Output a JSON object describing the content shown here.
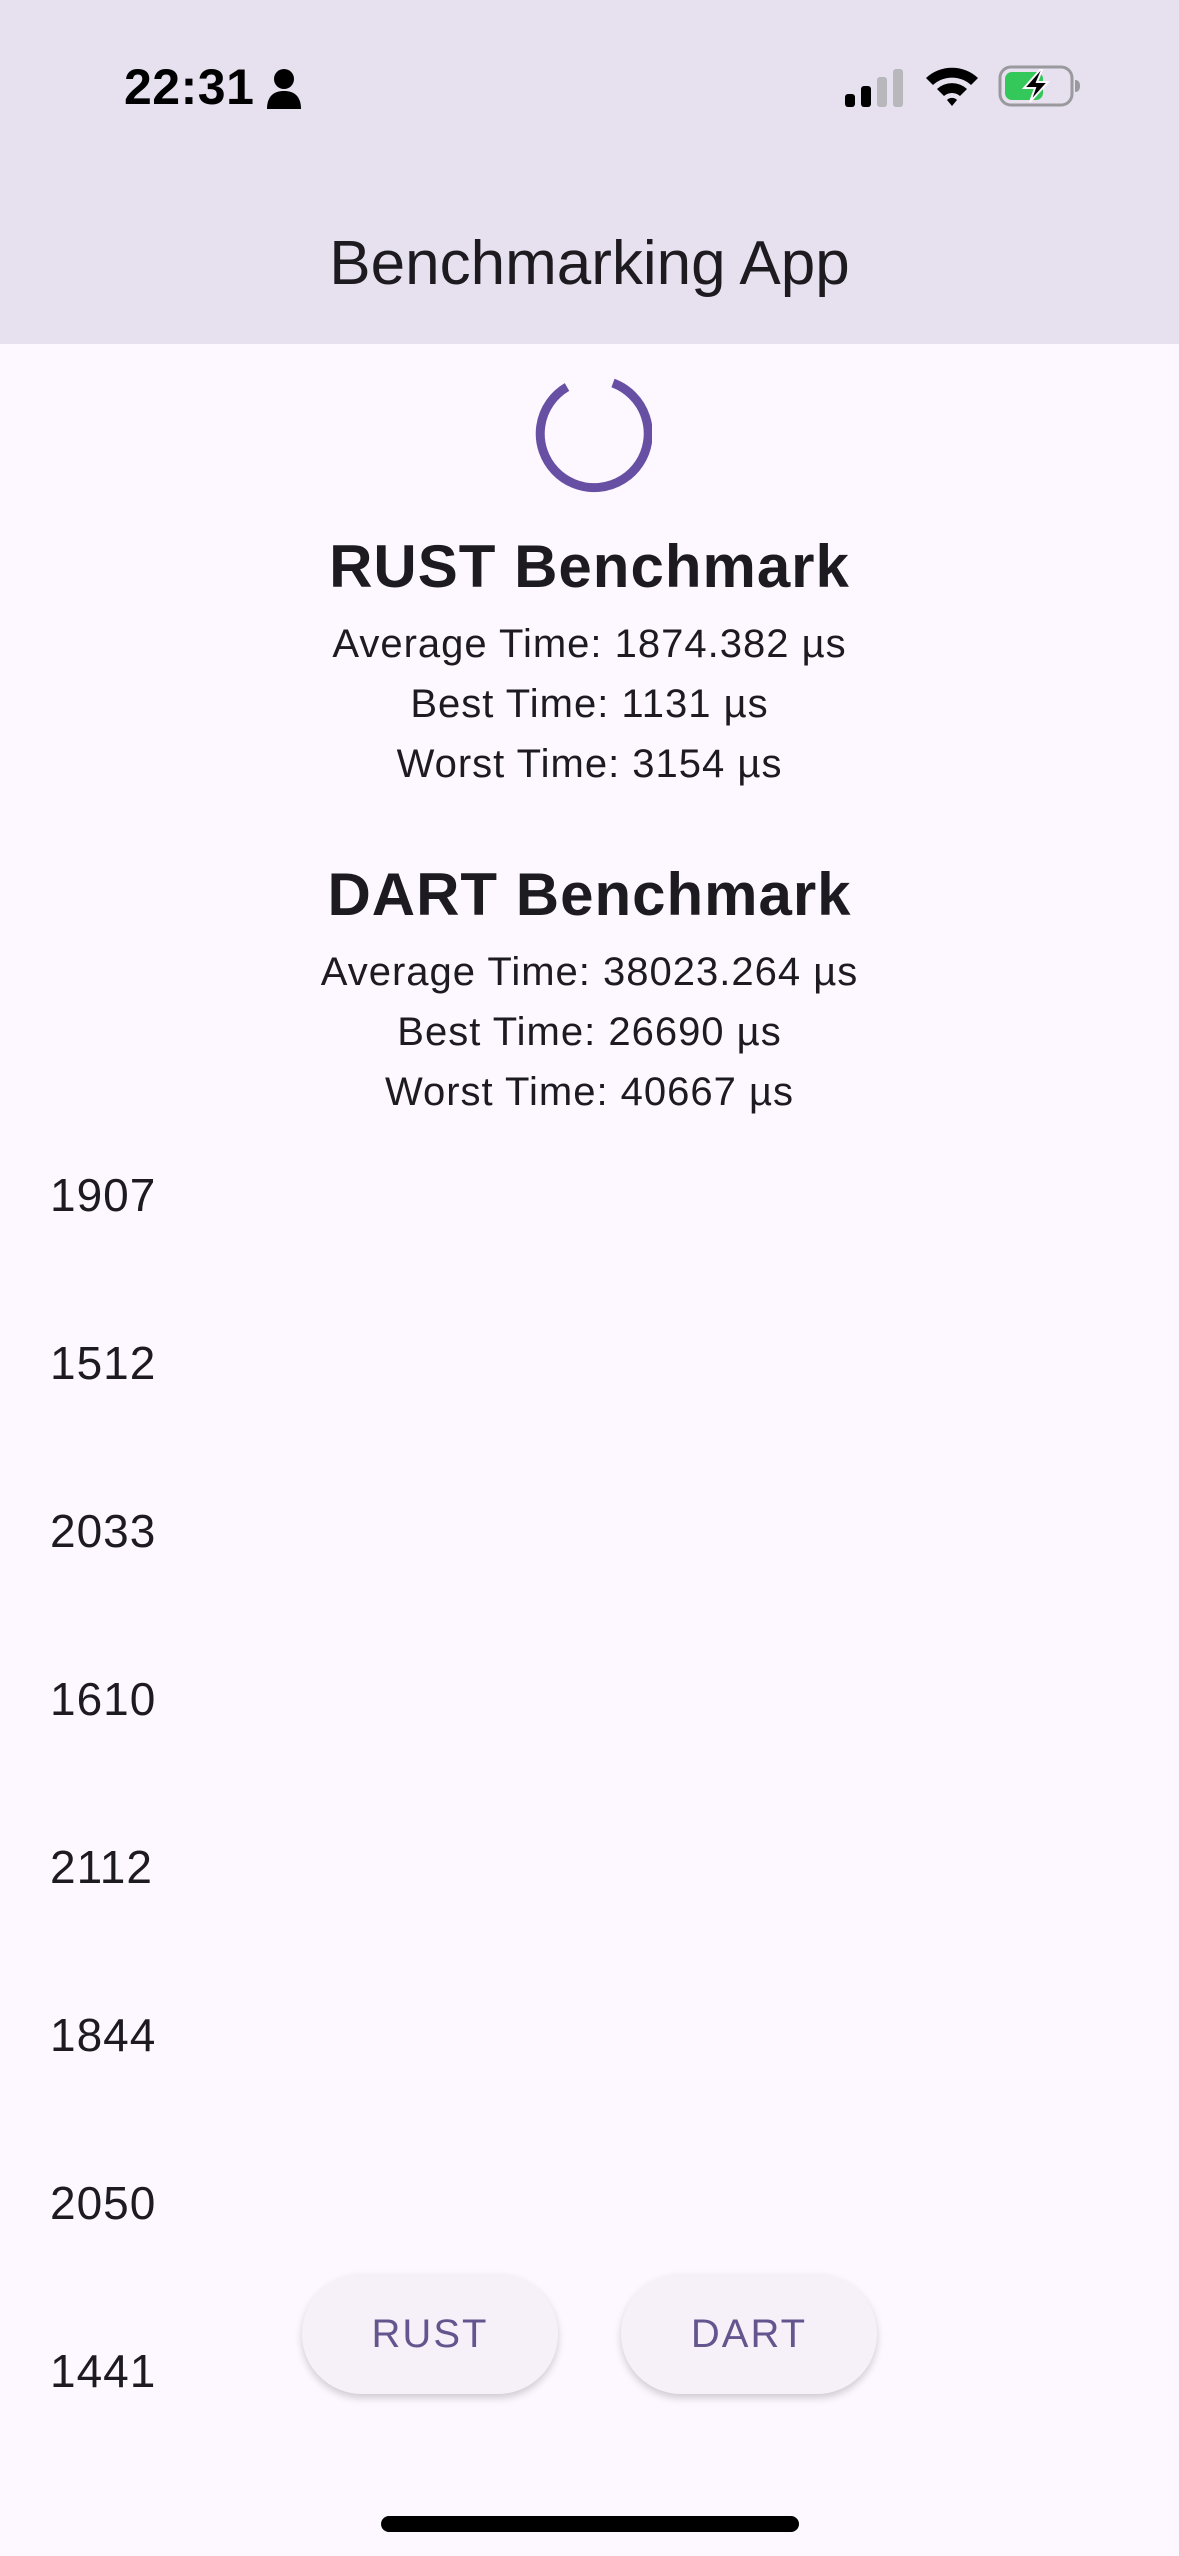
{
  "status_bar": {
    "time": "22:31",
    "icons": [
      "person-icon",
      "cellular-signal-icon",
      "wifi-icon",
      "battery-charging-icon"
    ]
  },
  "app_bar": {
    "title": "Benchmarking App"
  },
  "loading": {
    "icon": "circular-progress-icon",
    "color": "#6750a4"
  },
  "benchmarks": {
    "rust": {
      "title": "RUST Benchmark",
      "average": "Average Time: 1874.382 µs",
      "best": "Best Time: 1131 µs",
      "worst": "Worst Time: 3154 µs"
    },
    "dart": {
      "title": "DART Benchmark",
      "average": "Average Time: 38023.264 µs",
      "best": "Best Time: 26690 µs",
      "worst": "Worst Time: 40667 µs"
    }
  },
  "results": [
    "1907",
    "1512",
    "2033",
    "1610",
    "2112",
    "1844",
    "2050",
    "1441"
  ],
  "buttons": {
    "rust_label": "RUST",
    "dart_label": "DART"
  },
  "colors": {
    "app_bar_bg": "#e7e0ef",
    "background": "#fdf7ff",
    "accent": "#65558f",
    "battery_green": "#34c759"
  }
}
